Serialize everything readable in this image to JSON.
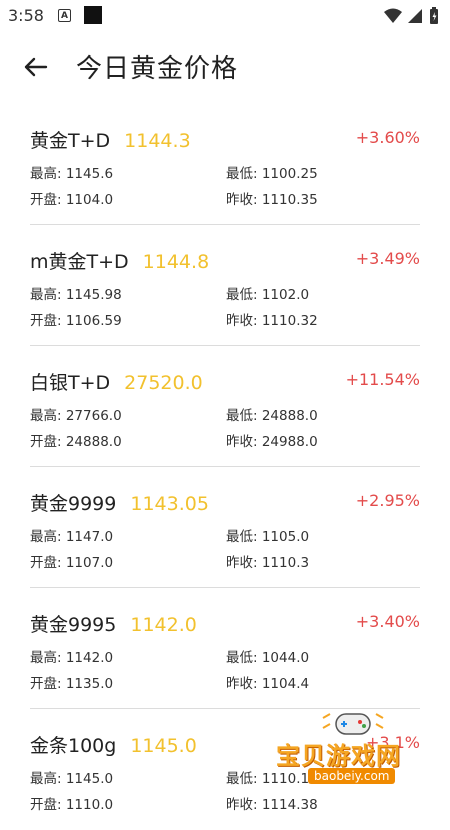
{
  "status_bar": {
    "time": "3:58",
    "a_icon_label": "A"
  },
  "header": {
    "title": "今日黄金价格"
  },
  "labels": {
    "high": "最高: ",
    "low": "最低: ",
    "open": "开盘: ",
    "prev_close": "昨收: "
  },
  "items": [
    {
      "name": "黄金T+D",
      "price": "1144.3",
      "change": "+3.60%",
      "high": "1145.6",
      "low": "1100.25",
      "open": "1104.0",
      "prev_close": "1110.35"
    },
    {
      "name": "m黄金T+D",
      "price": "1144.8",
      "change": "+3.49%",
      "high": "1145.98",
      "low": "1102.0",
      "open": "1106.59",
      "prev_close": "1110.32"
    },
    {
      "name": "白银T+D",
      "price": "27520.0",
      "change": "+11.54%",
      "high": "27766.0",
      "low": "24888.0",
      "open": "24888.0",
      "prev_close": "24988.0"
    },
    {
      "name": "黄金9999",
      "price": "1143.05",
      "change": "+2.95%",
      "high": "1147.0",
      "low": "1105.0",
      "open": "1107.0",
      "prev_close": "1110.3"
    },
    {
      "name": "黄金9995",
      "price": "1142.0",
      "change": "+3.40%",
      "high": "1142.0",
      "low": "1044.0",
      "open": "1135.0",
      "prev_close": "1104.4"
    },
    {
      "name": "金条100g",
      "price": "1145.0",
      "change": "+3.1%",
      "high": "1145.0",
      "low": "1110.1",
      "open": "1110.0",
      "prev_close": "1114.38"
    }
  ],
  "watermark": {
    "text": "宝贝游戏网",
    "url": "baobeiy.com"
  },
  "colors": {
    "price": "#f2c12e",
    "change_up": "#e34b4b",
    "divider": "#dcdcdc"
  }
}
